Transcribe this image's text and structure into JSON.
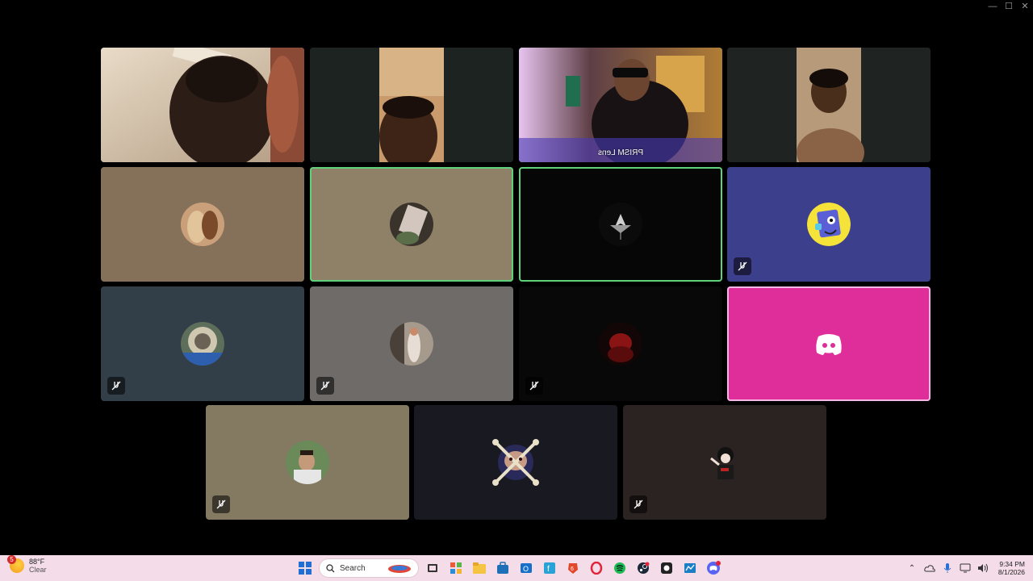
{
  "window_controls": {
    "minimize": "—",
    "maximize": "☐",
    "close": "✕"
  },
  "tiles": {
    "row1": {
      "t1": {
        "bg": "#c9b49a"
      },
      "t2": {
        "bg": "#1d2320"
      },
      "t3": {
        "bg": "#4a3a34",
        "camera_label": "PRISM Lens"
      },
      "t4": {
        "bg": "#1f2422"
      }
    },
    "row2": {
      "t1": {
        "bg": "#85705a"
      },
      "t2": {
        "bg": "#8f8068"
      },
      "t3": {
        "bg": "#060606"
      },
      "t4": {
        "bg": "#3c3f8c"
      }
    },
    "row3": {
      "t1": {
        "bg": "#323f48"
      },
      "t2": {
        "bg": "#6e6b68"
      },
      "t3": {
        "bg": "#080808"
      },
      "t4": {
        "bg": "#df2e9a"
      }
    },
    "row4": {
      "t1": {
        "bg": "#847a62"
      },
      "t2": {
        "bg": "#191922"
      },
      "t3": {
        "bg": "#2a2322"
      }
    }
  },
  "taskbar": {
    "weather": {
      "badge": "5",
      "temp": "88°F",
      "condition": "Clear"
    },
    "search": {
      "placeholder": "Search"
    },
    "apps": [
      "start-icon",
      "search-box",
      "game-icon",
      "task-view-icon",
      "copilot-icon",
      "file-explorer-icon",
      "store-icon",
      "outlook-icon",
      "f-app-icon",
      "brave-icon",
      "opera-icon",
      "spotify-icon",
      "steam-icon",
      "app-icon",
      "code-icon",
      "discord-icon"
    ],
    "clock": {
      "time": "9:34 PM",
      "date": "8/1/2026"
    }
  }
}
